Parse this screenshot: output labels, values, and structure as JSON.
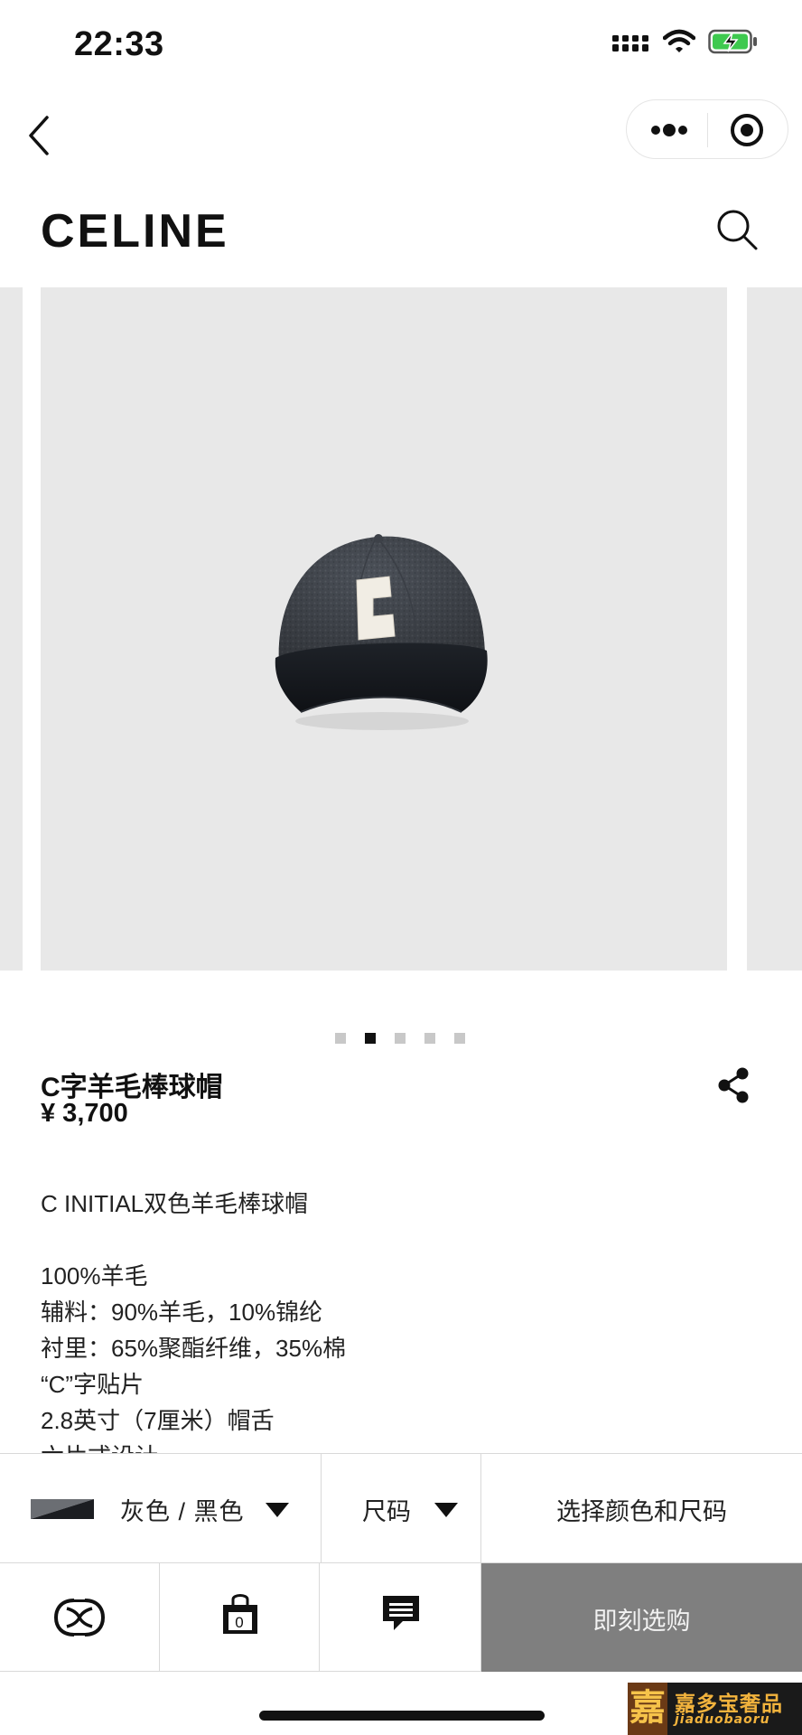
{
  "status_bar": {
    "time": "22:33",
    "icons": [
      "signal-icon",
      "wifi-icon",
      "battery-charging-icon"
    ]
  },
  "nav": {
    "icons": [
      "back-arrow-icon",
      "more-dots-icon",
      "miniprogram-close-icon"
    ]
  },
  "header": {
    "logo_text": "CELINE",
    "search_icon": "search-icon"
  },
  "gallery": {
    "slide_count": 5,
    "active_index": 1,
    "image_subject": "baseball-cap-grey-wool-black-visor-white-c-patch",
    "patch_letter": "C"
  },
  "product": {
    "name": "C字羊毛棒球帽",
    "price": "¥ 3,700",
    "share_icon": "share-icon",
    "description": [
      "C INITIAL双色羊毛棒球帽",
      "",
      "100%羊毛",
      "辅料：90%羊毛，10%锦纶",
      "衬里：65%聚酯纤维，35%棉",
      "“C”字贴片",
      "2.8英寸（7厘米）帽舌",
      "六片式设计"
    ]
  },
  "selectors": {
    "color_label": "灰色 / 黑色",
    "size_label": "尺码",
    "prompt_label": "选择颜色和尺码"
  },
  "actions": {
    "logo_icon": "celine-triomphe-icon",
    "bag_icon": "shopping-bag-icon",
    "bag_count": "0",
    "chat_icon": "chat-icon",
    "buy_label": "即刻选购"
  },
  "watermark": {
    "seal": "嘉",
    "chinese": "嘉多宝奢品",
    "latin": "jiaduobaoru"
  },
  "colors": {
    "background": "#ffffff",
    "image_bg": "#e8e8e8",
    "buy_button": "#7f7f7f",
    "text": "#111111",
    "border": "#d9d9d9"
  }
}
